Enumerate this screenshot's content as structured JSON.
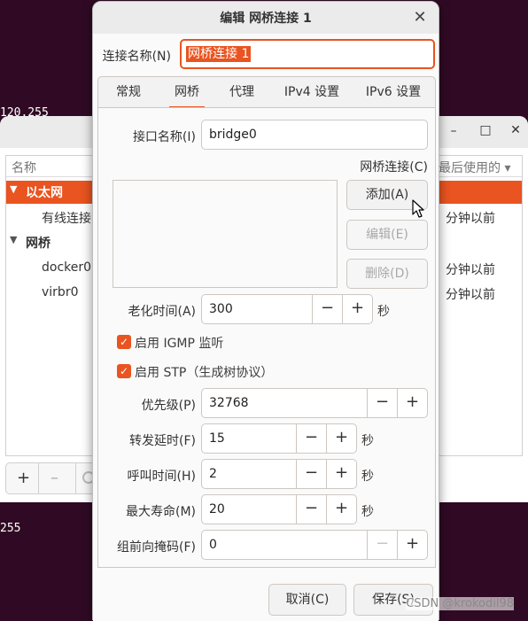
{
  "terminal": {
    "line1": "120.255",
    "line2": "255"
  },
  "back_window": {
    "controls": {
      "minimize": "–",
      "maximize": "□",
      "close": "✕"
    },
    "header": {
      "name_col": "名称",
      "last_used_col": "最后使用的 ▾"
    },
    "groups": [
      {
        "label": "以太网",
        "items": [
          {
            "name": "有线连接",
            "last_used": "分钟以前"
          }
        ]
      },
      {
        "label": "网桥",
        "items": [
          {
            "name": "docker0",
            "last_used": "分钟以前"
          },
          {
            "name": "virbr0",
            "last_used": "分钟以前"
          }
        ]
      }
    ],
    "toolbar": {
      "add": "+",
      "remove": "–"
    }
  },
  "dialog": {
    "title": "编辑 网桥连接 1",
    "close": "✕",
    "connection_name": {
      "label": "连接名称(N)",
      "value": "网桥连接 1"
    },
    "tabs": [
      "常规",
      "网桥",
      "代理",
      "IPv4 设置",
      "IPv6 设置"
    ],
    "active_tab": "网桥",
    "bridge": {
      "interface_label": "接口名称(I)",
      "interface_value": "bridge0",
      "connections_label": "网桥连接(C)",
      "add_button": "添加(A)",
      "edit_button": "编辑(E)",
      "delete_button": "删除(D)",
      "aging": {
        "label": "老化时间(A)",
        "value": "300",
        "unit": "秒"
      },
      "igmp_label": "启用 IGMP 监听",
      "stp_label": "启用 STP（生成树协议）",
      "priority": {
        "label": "优先级(P)",
        "value": "32768"
      },
      "forward_delay": {
        "label": "转发延时(F)",
        "value": "15",
        "unit": "秒"
      },
      "hello_time": {
        "label": "呼叫时间(H)",
        "value": "2",
        "unit": "秒"
      },
      "max_age": {
        "label": "最大寿命(M)",
        "value": "20",
        "unit": "秒"
      },
      "group_mask": {
        "label": "组前向掩码(F)",
        "value": "0"
      },
      "minus": "−",
      "plus": "+"
    },
    "cancel_button": "取消(C)",
    "save_button": "保存(S)"
  },
  "watermark": "CSDN @krokodil98",
  "colors": {
    "accent": "#e95420",
    "terminal_bg": "#300a24"
  }
}
